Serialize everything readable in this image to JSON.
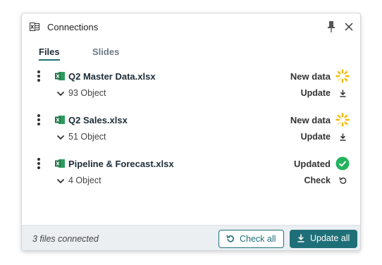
{
  "panel": {
    "title": "Connections",
    "icons": {
      "title": "excel-icon",
      "pin": "pin-icon",
      "close": "close-icon"
    }
  },
  "tabs": [
    {
      "label": "Files",
      "active": true
    },
    {
      "label": "Slides",
      "active": false
    }
  ],
  "files": [
    {
      "name": "Q2 Master Data.xlsx",
      "status": "New data",
      "status_icon": "loading-spinner-icon",
      "objects": "93 Object",
      "action": "Update",
      "action_icon": "download-icon"
    },
    {
      "name": "Q2 Sales.xlsx",
      "status": "New data",
      "status_icon": "loading-spinner-icon",
      "objects": "51 Object",
      "action": "Update",
      "action_icon": "download-icon"
    },
    {
      "name": "Pipeline & Forecast.xlsx",
      "status": "Updated",
      "status_icon": "check-circle-icon",
      "objects": "4 Object",
      "action": "Check",
      "action_icon": "refresh-icon"
    }
  ],
  "footer": {
    "status": "3 files connected",
    "check_all_label": "Check all",
    "update_all_label": "Update all"
  },
  "colors": {
    "accent": "#1f6f78",
    "excel_green": "#1e7145",
    "spinner": "#f5b800",
    "success": "#22b35e",
    "footer_bg": "#ebeff2"
  }
}
